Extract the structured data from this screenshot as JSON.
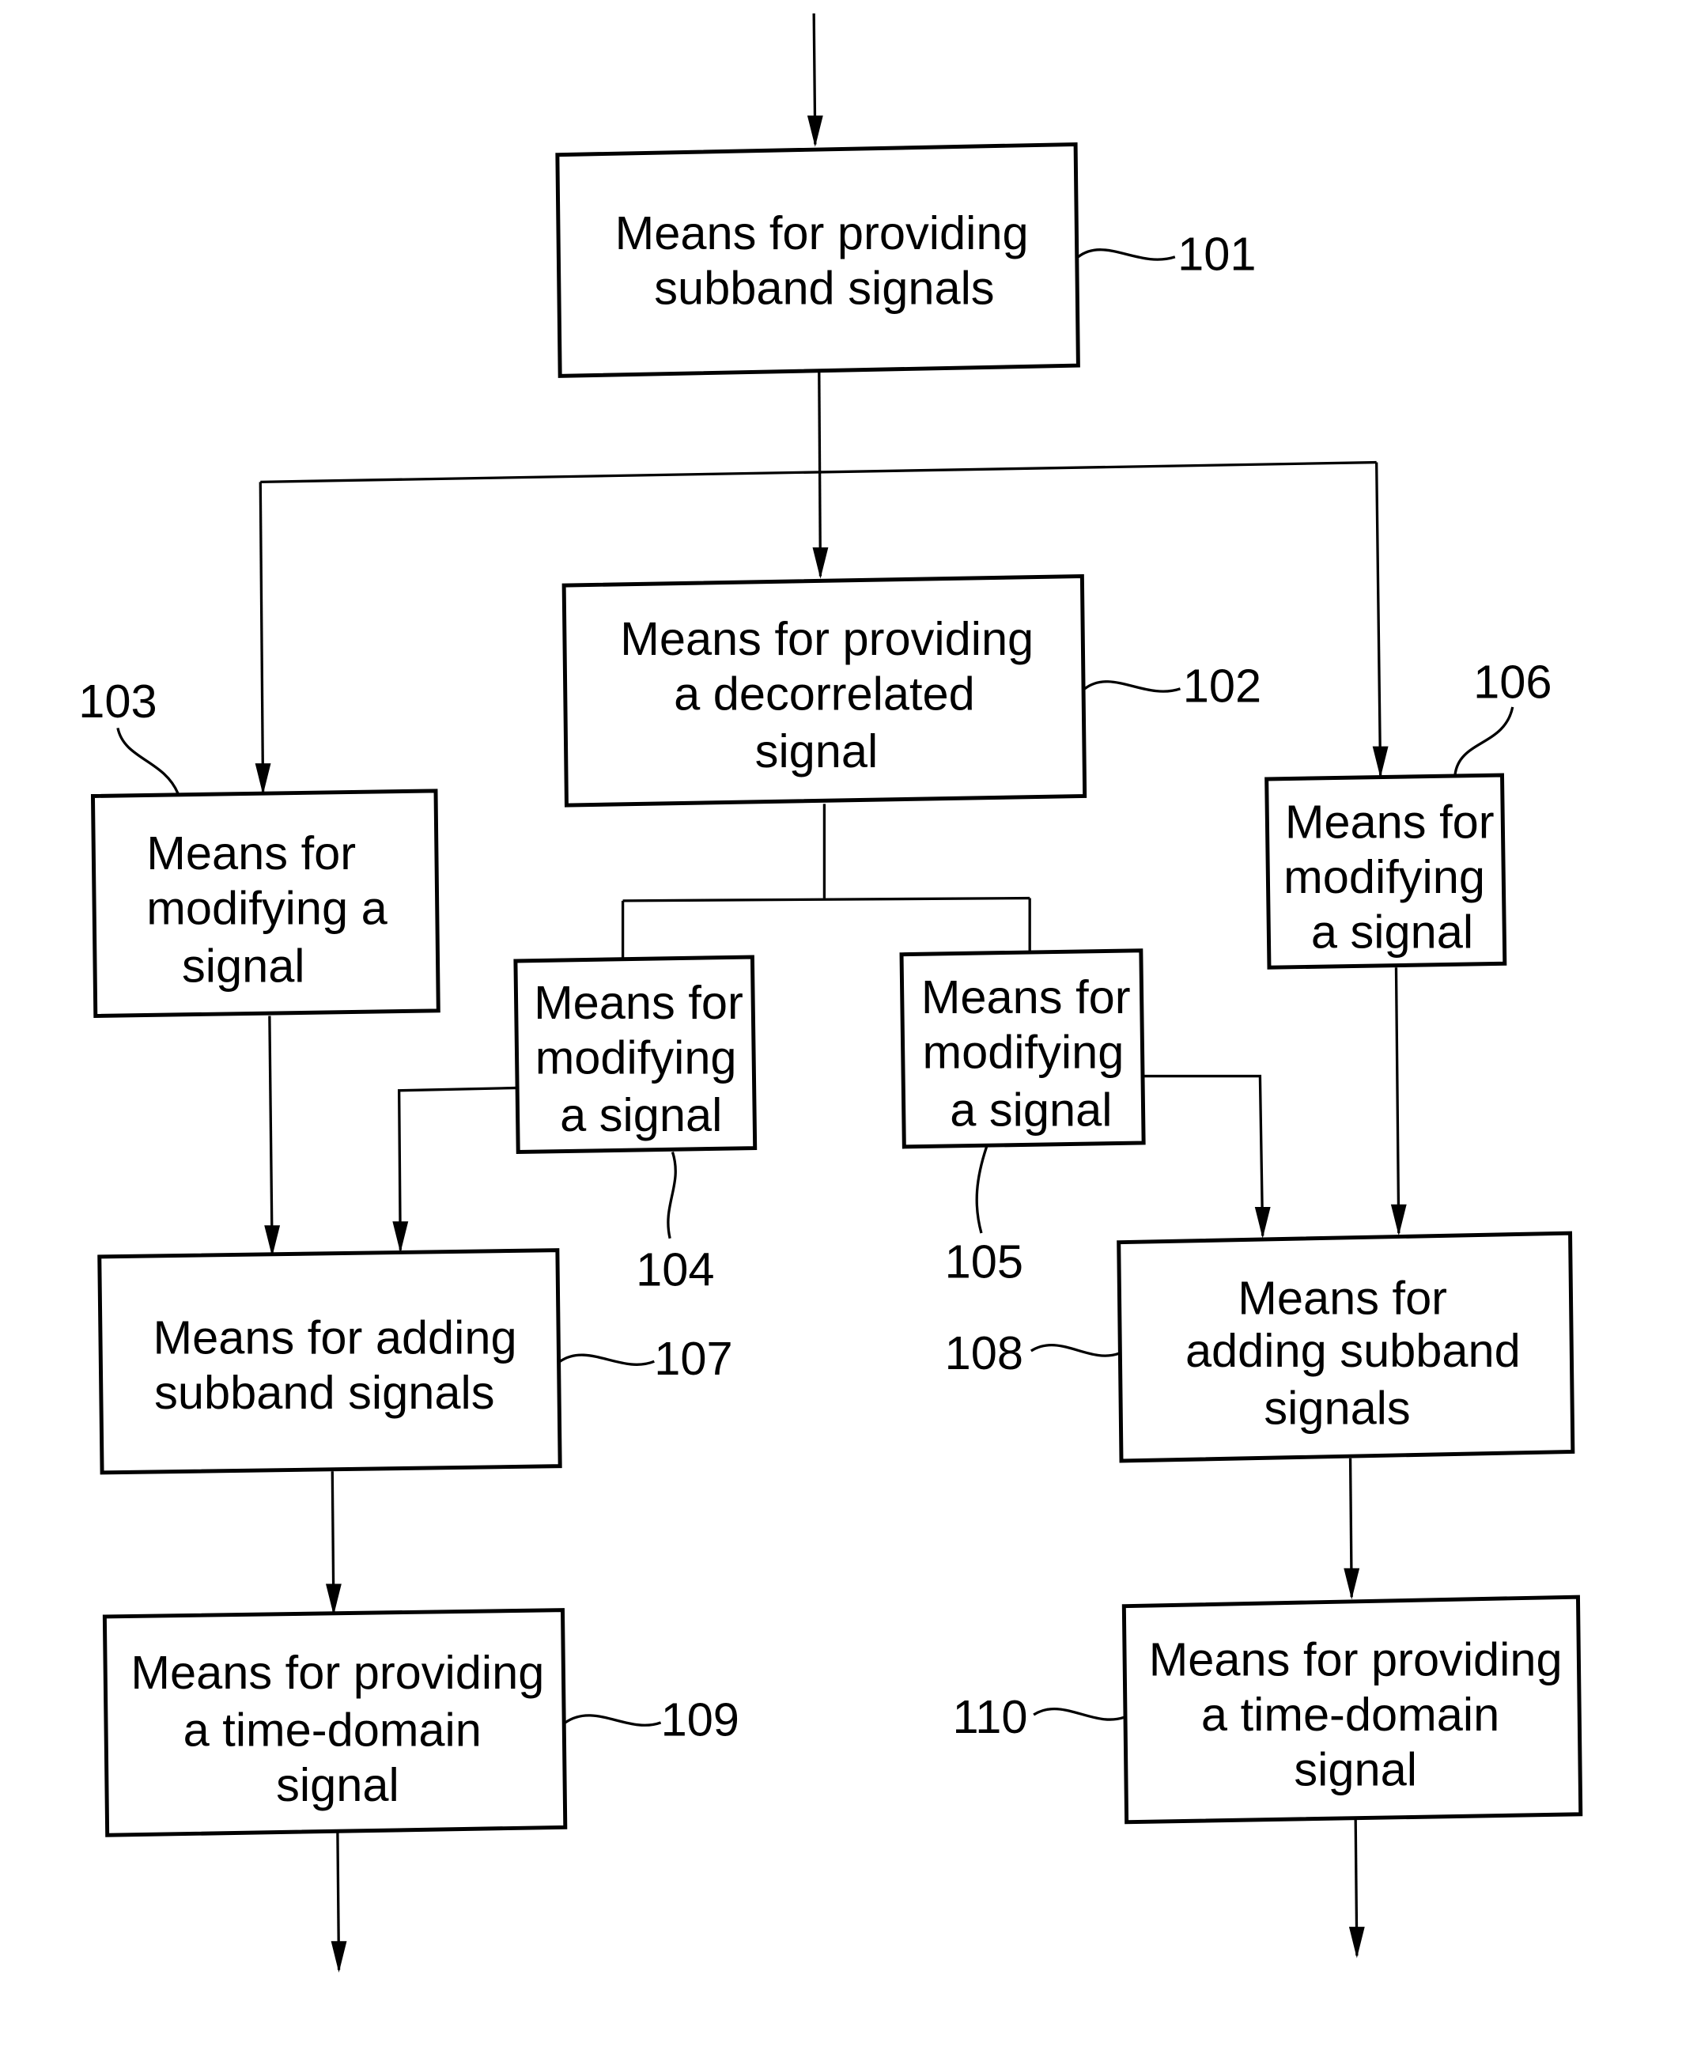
{
  "diagram": {
    "type": "block-diagram",
    "blocks": [
      {
        "id": "101",
        "ref": "101",
        "lines": [
          "Means for providing",
          "subband signals"
        ]
      },
      {
        "id": "102",
        "ref": "102",
        "lines": [
          "Means for providing",
          "a  decorrelated",
          "signal"
        ]
      },
      {
        "id": "103",
        "ref": "103",
        "lines": [
          "Means for",
          "modifying a",
          "signal"
        ]
      },
      {
        "id": "104",
        "ref": "104",
        "lines": [
          "Means for",
          "modifying",
          "a signal"
        ]
      },
      {
        "id": "105",
        "ref": "105",
        "lines": [
          "Means for",
          "modifying",
          "a signal"
        ]
      },
      {
        "id": "106",
        "ref": "106",
        "lines": [
          "Means for",
          "modifying",
          "a signal"
        ]
      },
      {
        "id": "107",
        "ref": "107",
        "lines": [
          "Means for adding",
          "subband signals"
        ]
      },
      {
        "id": "108",
        "ref": "108",
        "lines": [
          "Means for",
          "adding subband",
          "signals"
        ]
      },
      {
        "id": "109",
        "ref": "109",
        "lines": [
          "Means for providing",
          "a time-domain",
          "signal"
        ]
      },
      {
        "id": "110",
        "ref": "110",
        "lines": [
          "Means for providing",
          "a time-domain",
          "signal"
        ]
      }
    ],
    "connections": [
      {
        "from": "input",
        "to": "101"
      },
      {
        "from": "101",
        "to": "102"
      },
      {
        "from": "101",
        "to": "103"
      },
      {
        "from": "101",
        "to": "106"
      },
      {
        "from": "102",
        "to": "104"
      },
      {
        "from": "102",
        "to": "105"
      },
      {
        "from": "103",
        "to": "107"
      },
      {
        "from": "104",
        "to": "107"
      },
      {
        "from": "105",
        "to": "108"
      },
      {
        "from": "106",
        "to": "108"
      },
      {
        "from": "107",
        "to": "109"
      },
      {
        "from": "108",
        "to": "110"
      },
      {
        "from": "109",
        "to": "output"
      },
      {
        "from": "110",
        "to": "output"
      }
    ]
  }
}
